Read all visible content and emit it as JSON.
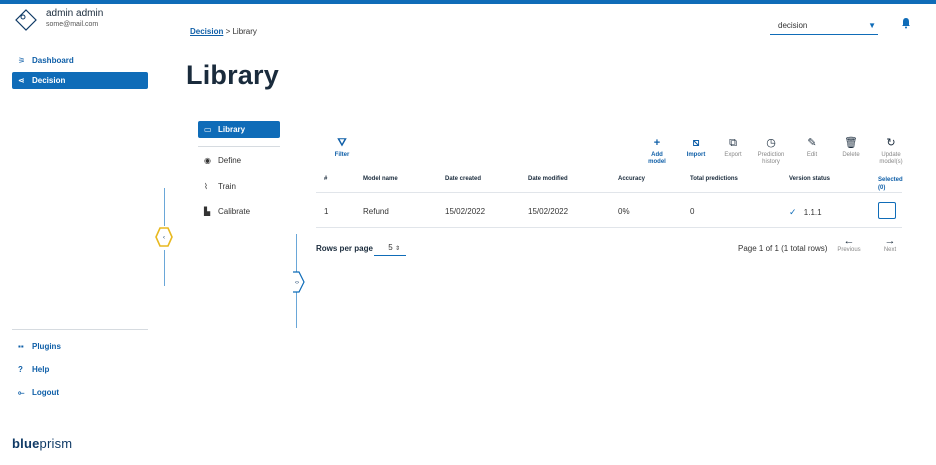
{
  "user": {
    "name": "admin admin",
    "email": "some@mail.com"
  },
  "sidebar": {
    "items": [
      {
        "label": "Dashboard",
        "icon": "dashboard-icon"
      },
      {
        "label": "Decision",
        "icon": "share-icon",
        "active": true
      }
    ],
    "bottom_items": [
      {
        "label": "Plugins",
        "icon": "plugins-icon"
      },
      {
        "label": "Help",
        "icon": "help-icon"
      },
      {
        "label": "Logout",
        "icon": "logout-icon"
      }
    ],
    "brand_bold": "blue",
    "brand_light": "prism"
  },
  "header": {
    "breadcrumb_link": "Decision",
    "breadcrumb_sep": " > ",
    "breadcrumb_current": "Library",
    "select_value": "decision",
    "page_title": "Library"
  },
  "subnav": [
    {
      "label": "Library",
      "active": true
    },
    {
      "label": "Define"
    },
    {
      "label": "Train"
    },
    {
      "label": "Calibrate"
    }
  ],
  "toolbar": {
    "filter": "Filter",
    "add_model_1": "Add",
    "add_model_2": "model",
    "import": "Import",
    "export": "Export",
    "prediction_history_1": "Prediction",
    "prediction_history_2": "history",
    "edit": "Edit",
    "delete": "Delete",
    "update_models_1": "Update",
    "update_models_2": "model(s)"
  },
  "table": {
    "columns": [
      "#",
      "Model name",
      "Date created",
      "Date modified",
      "Accuracy",
      "Total predictions",
      "Version status",
      "Selected",
      "(0)"
    ],
    "rows": [
      {
        "num": "1",
        "model_name": "Refund",
        "date_created": "15/02/2022",
        "date_modified": "15/02/2022",
        "accuracy": "0%",
        "total_predictions": "0",
        "version": "1.1.1"
      }
    ]
  },
  "pagination": {
    "rows_per_page_label": "Rows per page",
    "rows_per_page_value": "5",
    "page_info": "Page 1 of 1 (1 total rows)",
    "previous": "Previous",
    "next": "Next"
  },
  "colors": {
    "accent": "#0f6cb8",
    "handle": "#e8b920"
  }
}
